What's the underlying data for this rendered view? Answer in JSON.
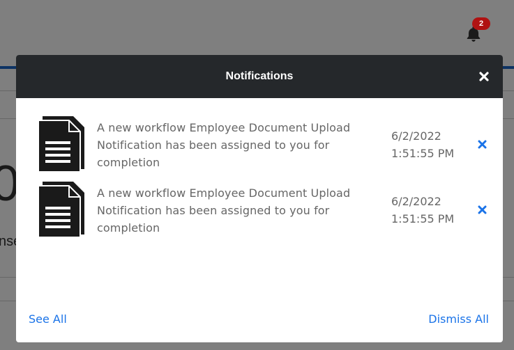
{
  "header": {
    "notification_count": "2"
  },
  "background": {
    "big_text": "0",
    "small_text": "nse"
  },
  "modal": {
    "title": "Notifications",
    "close_icon": "close-icon",
    "items": [
      {
        "message": "A new workflow Employee Document Upload Notification has been assigned to you for completion",
        "date": "6/2/2022",
        "time": "1:51:55 PM",
        "icon": "document-icon"
      },
      {
        "message": "A new workflow Employee Document Upload Notification has been assigned to you for completion",
        "date": "6/2/2022",
        "time": "1:51:55 PM",
        "icon": "document-icon"
      }
    ],
    "see_all_label": "See All",
    "dismiss_all_label": "Dismiss All"
  },
  "colors": {
    "accent": "#1a73e8",
    "modal_header": "#25282b",
    "badge": "#b01212"
  }
}
